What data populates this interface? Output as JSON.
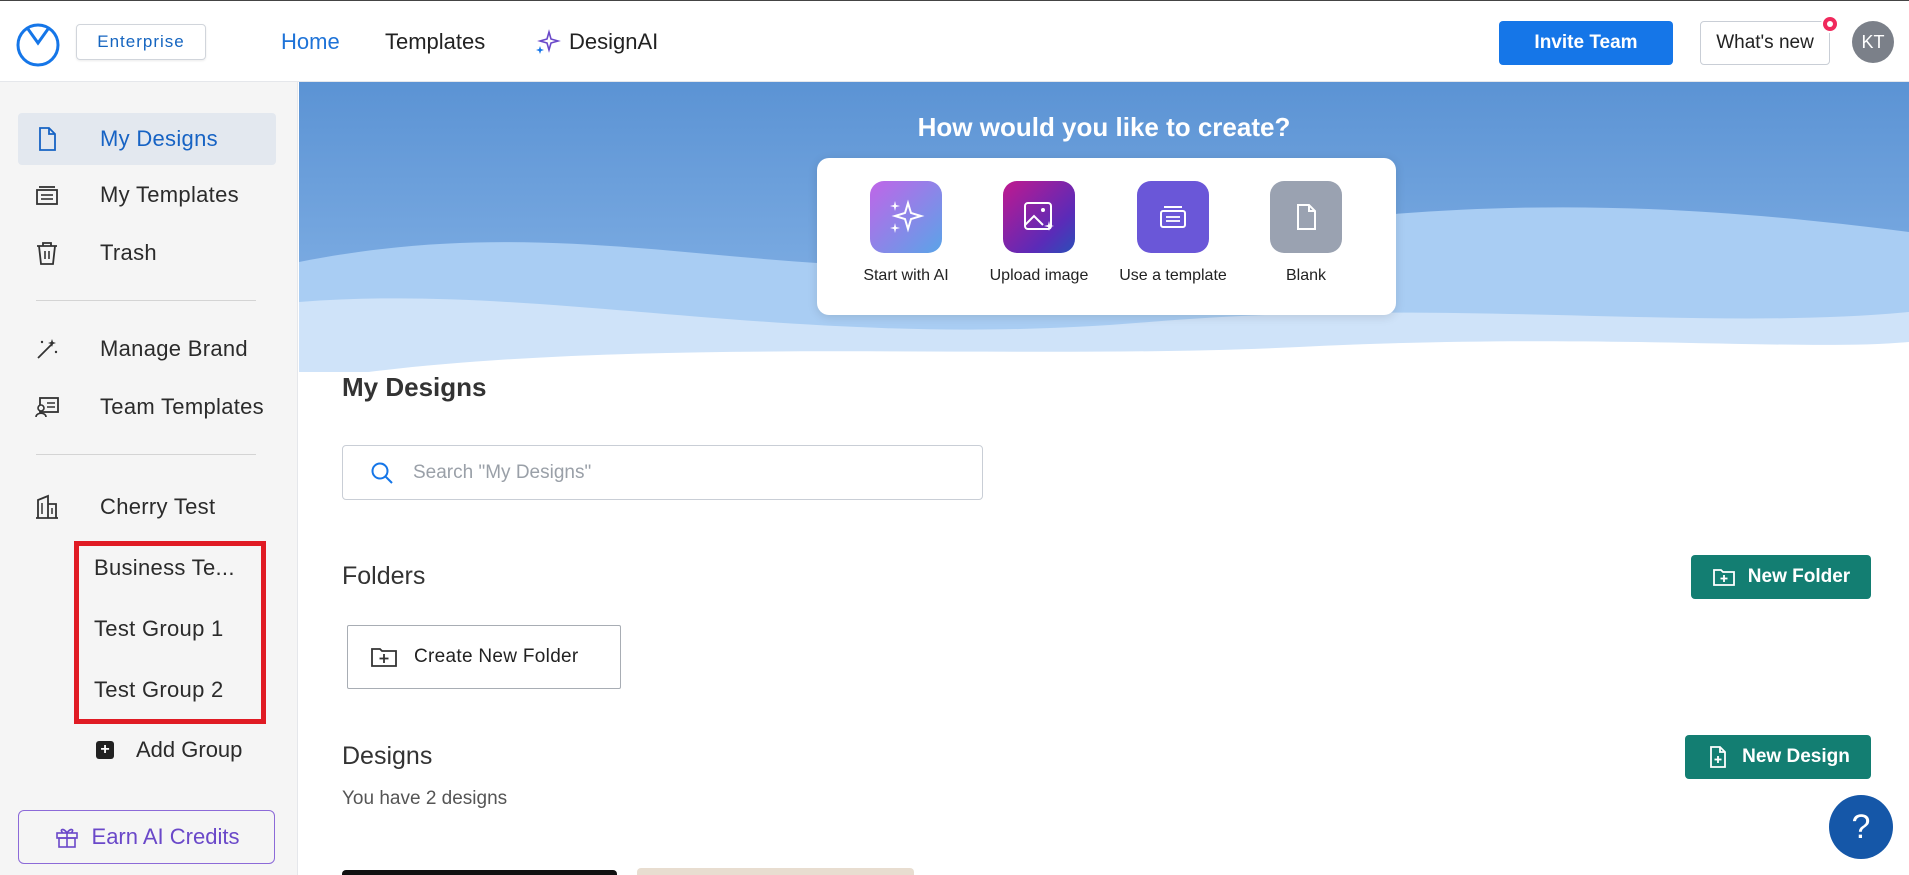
{
  "header": {
    "plan_badge": "Enterprise",
    "nav": [
      {
        "label": "Home"
      },
      {
        "label": "Templates"
      },
      {
        "label": "DesignAI"
      }
    ],
    "invite_label": "Invite Team",
    "whats_new_label": "What's new",
    "avatar_initials": "KT"
  },
  "sidebar": {
    "items": [
      {
        "label": "My Designs",
        "icon": "document-icon"
      },
      {
        "label": "My Templates",
        "icon": "templates-icon"
      },
      {
        "label": "Trash",
        "icon": "trash-icon"
      },
      {
        "label": "Manage Brand",
        "icon": "magic-wand-icon"
      },
      {
        "label": "Team Templates",
        "icon": "team-templates-icon"
      },
      {
        "label": "Cherry Test",
        "icon": "building-icon"
      }
    ],
    "groups": [
      "Business Te...",
      "Test Group 1",
      "Test Group 2"
    ],
    "add_group_label": "Add Group",
    "earn_credits_label": "Earn AI Credits"
  },
  "hero": {
    "title": "How would you like to create?",
    "options": [
      {
        "label": "Start with AI",
        "icon": "sparkles-icon"
      },
      {
        "label": "Upload image",
        "icon": "image-upload-icon"
      },
      {
        "label": "Use a template",
        "icon": "template-icon"
      },
      {
        "label": "Blank",
        "icon": "blank-page-icon"
      }
    ]
  },
  "main": {
    "section_title": "My Designs",
    "search_placeholder": "Search \"My Designs\"",
    "folders_title": "Folders",
    "new_folder_label": "New Folder",
    "create_folder_label": "Create New Folder",
    "designs_title": "Designs",
    "new_design_label": "New Design",
    "designs_count_text": "You have 2 designs"
  },
  "help_label": "?",
  "colors": {
    "primary_blue": "#1576e8",
    "green": "#137e72",
    "highlight_red": "#e01b24",
    "purple": "#6a48c9"
  }
}
